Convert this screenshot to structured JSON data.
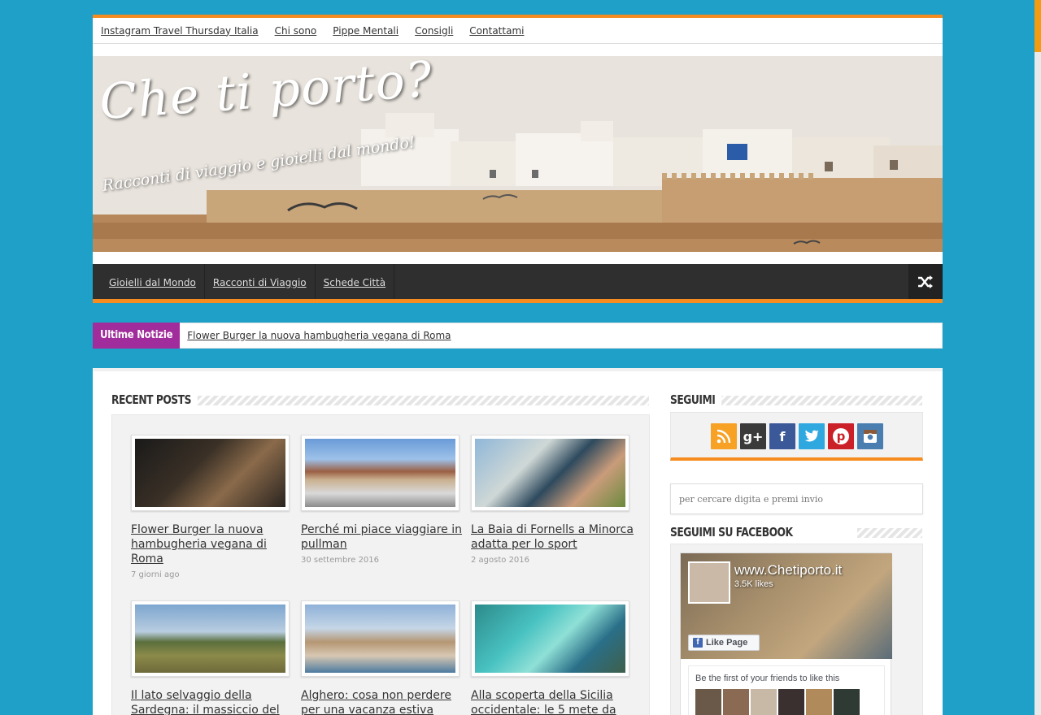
{
  "top_nav": {
    "items": [
      "Instagram Travel Thursday Italia",
      "Chi sono",
      "Pippe Mentali",
      "Consigli",
      "Contattami"
    ]
  },
  "header": {
    "logo_title": "Che ti porto?",
    "logo_tagline": "Racconti di viaggio e gioielli dal mondo!"
  },
  "main_nav": {
    "items": [
      "Gioielli dal Mondo",
      "Racconti di Viaggio",
      "Schede Città"
    ],
    "random_icon": "shuffle-icon"
  },
  "breaking": {
    "label": "Ultime Notizie",
    "headline": "Flower Burger la nuova hambugheria vegana di Roma"
  },
  "recent_posts": {
    "title": "Recent Posts",
    "posts": [
      {
        "title": "Flower Burger la nuova hambugheria vegana di Roma",
        "date": "7 giorni ago"
      },
      {
        "title": "Perché mi piace viaggiare in pullman",
        "date": "30 settembre 2016"
      },
      {
        "title": "La Baia di Fornells a Minorca adatta per lo sport",
        "date": "2 agosto 2016"
      },
      {
        "title": "Il lato selvaggio della Sardegna: il massiccio del",
        "date": ""
      },
      {
        "title": "Alghero: cosa non perdere per una vacanza estiva",
        "date": ""
      },
      {
        "title": "Alla scoperta della Sicilia occidentale: le 5 mete da",
        "date": ""
      }
    ]
  },
  "sidebar": {
    "social_title": "Seguimi",
    "social_icons": [
      "rss-icon",
      "google-plus-icon",
      "facebook-icon",
      "twitter-icon",
      "pinterest-icon",
      "instagram-icon"
    ],
    "social_colors": {
      "rss": "#f7a125",
      "google_plus": "#3a3a3a",
      "facebook": "#3b5998",
      "twitter": "#2fa8e0",
      "pinterest": "#cb2027",
      "instagram": "#4b7eb0"
    },
    "search_placeholder": "per cercare digita e premi invio",
    "facebook_title": "Seguimi su Facebook",
    "facebook": {
      "page_name": "www.Chetiporto.it",
      "likes": "3.5K likes",
      "like_button": "Like Page",
      "friends_text": "Be the first of your friends to like this"
    }
  },
  "colors": {
    "background": "#1ea0c8",
    "accent": "#f68b1f",
    "breaking_badge": "#a12c9b",
    "nav_bg": "#2f2f2f"
  }
}
